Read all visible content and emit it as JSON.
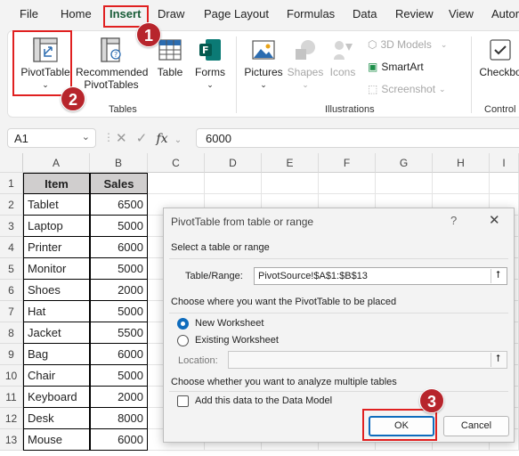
{
  "menu": {
    "tabs": [
      "File",
      "Home",
      "Insert",
      "Draw",
      "Page Layout",
      "Formulas",
      "Data",
      "Review",
      "View",
      "Autor"
    ]
  },
  "ribbon": {
    "pivottable": "PivotTable",
    "recommended_line1": "Recommended",
    "recommended_line2": "PivotTables",
    "table": "Table",
    "forms": "Forms",
    "group_tables": "Tables",
    "pictures": "Pictures",
    "shapes": "Shapes",
    "icons": "Icons",
    "models_3d": "3D Models",
    "smartart": "SmartArt",
    "screenshot": "Screenshot",
    "group_illustrations": "Illustrations",
    "checkbox": "Checkbo",
    "group_controls": "Control"
  },
  "formula_bar": {
    "name_box": "A1",
    "fx": "fx",
    "value": "6000"
  },
  "sheet": {
    "columns": [
      "A",
      "B",
      "C",
      "D",
      "E",
      "F",
      "G",
      "H",
      "I"
    ],
    "rows": [
      "1",
      "2",
      "3",
      "4",
      "5",
      "6",
      "7",
      "8",
      "9",
      "10",
      "11",
      "12",
      "13"
    ],
    "header": {
      "item": "Item",
      "sales": "Sales"
    },
    "data": [
      {
        "item": "Tablet",
        "sales": "6500"
      },
      {
        "item": "Laptop",
        "sales": "5000"
      },
      {
        "item": "Printer",
        "sales": "6000"
      },
      {
        "item": "Monitor",
        "sales": "5000"
      },
      {
        "item": "Shoes",
        "sales": "2000"
      },
      {
        "item": "Hat",
        "sales": "5000"
      },
      {
        "item": "Jacket",
        "sales": "5500"
      },
      {
        "item": "Bag",
        "sales": "6000"
      },
      {
        "item": "Chair",
        "sales": "5000"
      },
      {
        "item": "Keyboard",
        "sales": "2000"
      },
      {
        "item": "Desk",
        "sales": "8000"
      },
      {
        "item": "Mouse",
        "sales": "6000"
      }
    ]
  },
  "dialog": {
    "title": "PivotTable from table or range",
    "help": "?",
    "close": "✕",
    "section_select": "Select a table or range",
    "table_range_label": "Table/Range:",
    "table_range_value": "PivotSource!$A$1:$B$13",
    "section_place": "Choose where you want the PivotTable to be placed",
    "new_worksheet": "New Worksheet",
    "existing_worksheet": "Existing Worksheet",
    "location_label": "Location:",
    "section_multi": "Choose whether you want to analyze multiple tables",
    "data_model": "Add this data to the Data Model",
    "ok": "OK",
    "cancel": "Cancel"
  },
  "annotations": {
    "step1": "1",
    "step2": "2",
    "step3": "3"
  },
  "colors": {
    "accent": "#185c37",
    "annotation_red": "#e02020",
    "badge": "#b7252c",
    "primary_blue": "#0f6cbd"
  }
}
